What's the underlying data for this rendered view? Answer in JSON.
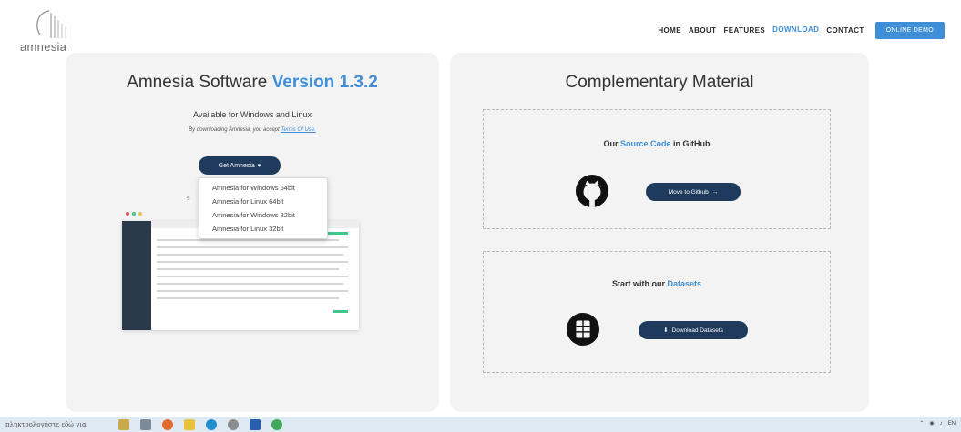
{
  "logo": {
    "text": "amnesia",
    "icon": "amnesia-logo-icon"
  },
  "nav": {
    "items": [
      "HOME",
      "ABOUT",
      "FEATURES",
      "DOWNLOAD",
      "CONTACT"
    ],
    "active": "DOWNLOAD",
    "demo_label": "ONLINE DEMO"
  },
  "left": {
    "title_prefix": "Amnesia Software",
    "title_version": "Version 1.3.2",
    "available": "Available for Windows and Linux",
    "accept_prefix": "By downloading Amnesia, you accept",
    "accept_link": "Terms Of Use.",
    "get_button": "Get Amnesia",
    "dropdown": [
      "Amnesia for Windows 64bit",
      "Amnesia for Linux 64bit",
      "Amnesia for Windows 32bit",
      "Amnesia for Linux 32bit"
    ],
    "side_char": "s"
  },
  "right": {
    "title": "Complementary Material",
    "github": {
      "head_prefix": "Our",
      "head_highlight": "Source Code",
      "head_suffix": "in GitHub",
      "button": "Move to Github",
      "button_icon": "arrow-right-icon",
      "icon": "github-icon"
    },
    "datasets": {
      "head_prefix": "Start with our",
      "head_highlight": "Datasets",
      "button": "Download Datasets",
      "button_icon": "download-icon",
      "icon": "database-icon"
    }
  },
  "taskbar": {
    "search": "πληκτρολογήστε εδώ για",
    "tray_lang": "EN"
  },
  "colors": {
    "accent": "#3f8fd8",
    "dark": "#1e3a5c",
    "card": "#f3f3f3"
  }
}
